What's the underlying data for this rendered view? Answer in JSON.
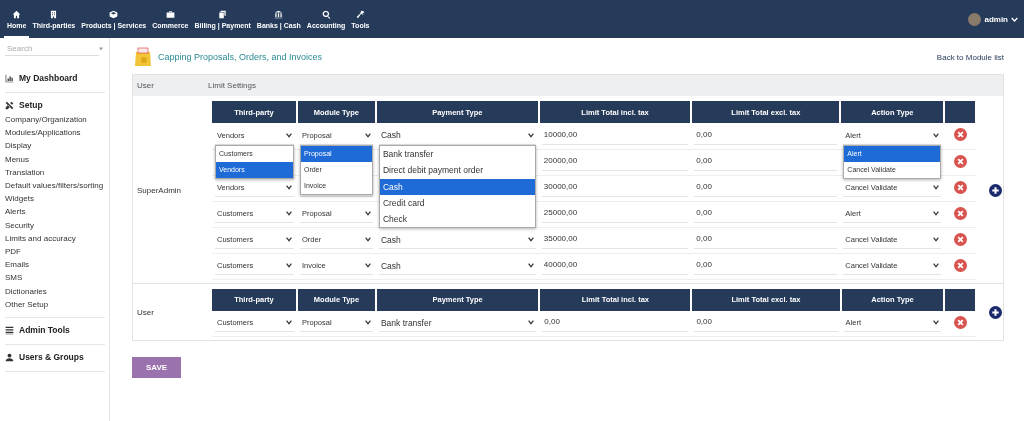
{
  "top_nav": {
    "items": [
      {
        "label": "Home",
        "selected": true
      },
      {
        "label": "Third-parties",
        "selected": false
      },
      {
        "label": "Products | Services",
        "selected": false
      },
      {
        "label": "Commerce",
        "selected": false
      },
      {
        "label": "Billing | Payment",
        "selected": false
      },
      {
        "label": "Banks | Cash",
        "selected": false
      },
      {
        "label": "Accounting",
        "selected": false
      },
      {
        "label": "Tools",
        "selected": false
      }
    ],
    "user": "admin"
  },
  "sidebar": {
    "search": {
      "placeholder": "Search"
    },
    "sections": [
      {
        "title": "My Dashboard"
      },
      {
        "title": "Setup",
        "items": [
          "Company/Organization",
          "Modules/Applications",
          "Display",
          "Menus",
          "Translation",
          "Default values/filters/sorting",
          "Widgets",
          "Alerts",
          "Security",
          "Limits and accuracy",
          "PDF",
          "Emails",
          "SMS",
          "Dictionaries",
          "Other Setup"
        ]
      },
      {
        "title": "Admin Tools"
      },
      {
        "title": "Users & Groups"
      }
    ]
  },
  "page": {
    "title": "Capping Proposals, Orders, and Invoices",
    "back_link": "Back to Module list"
  },
  "table": {
    "columns": [
      "User",
      "Limit Settings"
    ],
    "groups": [
      {
        "user": "SuperAdmin",
        "columns": [
          "Third-party",
          "Module Type",
          "Payment Type",
          "Limit Total incl. tax",
          "Limit Total excl. tax",
          "Action Type"
        ],
        "rows": [
          {
            "third_party": {
              "value": "Vendors",
              "options": [
                {
                  "label": "Customers",
                  "selected": false
                },
                {
                  "label": "Vendors",
                  "selected": true
                }
              ]
            },
            "module": {
              "value": "Proposal",
              "options": [
                {
                  "label": "Proposal",
                  "selected": true
                },
                {
                  "label": "Order",
                  "selected": false
                },
                {
                  "label": "Invoice",
                  "selected": false
                }
              ]
            },
            "payment": {
              "value": "Cash",
              "options": [
                {
                  "label": "Bank transfer",
                  "selected": false
                },
                {
                  "label": "Direct debit payment order",
                  "selected": false
                },
                {
                  "label": "Cash",
                  "selected": true
                },
                {
                  "label": "Credit card",
                  "selected": false
                },
                {
                  "label": "Check",
                  "selected": false
                }
              ]
            },
            "limit_incl": "10000,00",
            "limit_excl": "0,00",
            "action": {
              "value": "Alert",
              "options": [
                {
                  "label": "Alert",
                  "selected": true
                },
                {
                  "label": "Cancel Validate",
                  "selected": false
                }
              ]
            }
          },
          {
            "limit_incl": "20000,00",
            "limit_excl": "0,00"
          },
          {
            "third_party": {
              "value": "Vendors"
            },
            "limit_incl": "30000,00",
            "limit_excl": "0,00",
            "action": {
              "value": "Cancel Validate"
            }
          },
          {
            "third_party": {
              "value": "Customers"
            },
            "module": {
              "value": "Proposal"
            },
            "limit_incl": "25000,00",
            "limit_excl": "0,00",
            "action": {
              "value": "Alert"
            }
          },
          {
            "third_party": {
              "value": "Customers"
            },
            "module": {
              "value": "Order"
            },
            "payment": {
              "value": "Cash"
            },
            "limit_incl": "35000,00",
            "limit_excl": "0,00",
            "action": {
              "value": "Cancel Validate"
            }
          },
          {
            "third_party": {
              "value": "Customers"
            },
            "module": {
              "value": "Invoice"
            },
            "payment": {
              "value": "Cash"
            },
            "limit_incl": "40000,00",
            "limit_excl": "0,00",
            "action": {
              "value": "Cancel Validate"
            }
          }
        ]
      },
      {
        "user": "User",
        "columns": [
          "Third-party",
          "Module Type",
          "Payment Type",
          "Limit Total incl. tax",
          "Limit Total excl. tax",
          "Action Type"
        ],
        "rows": [
          {
            "third_party": {
              "value": "Customers"
            },
            "module": {
              "value": "Proposal"
            },
            "payment": {
              "value": "Bank transfer"
            },
            "limit_incl": "0,00",
            "limit_excl": "0,00",
            "action": {
              "value": "Alert"
            }
          }
        ]
      }
    ]
  },
  "save_button": "SAVE"
}
